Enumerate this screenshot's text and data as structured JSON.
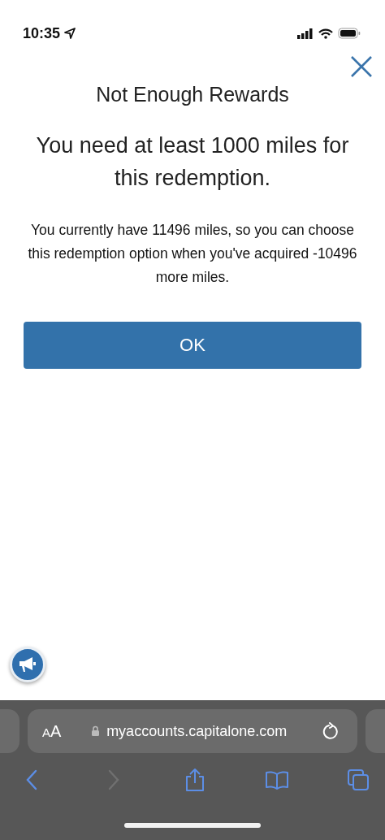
{
  "status_bar": {
    "time": "10:35"
  },
  "dialog": {
    "title": "Not Enough Rewards",
    "heading": "You need at least 1000 miles for this redemption.",
    "message": "You currently have 11496 miles, so you can choose this redemption option when you've acquired -10496 more miles.",
    "ok_button": "OK"
  },
  "browser": {
    "text_size_label": "AA",
    "url": "myaccounts.capitalone.com",
    "toolbar": [
      {
        "kind": "back",
        "disabled": false
      },
      {
        "kind": "forward",
        "disabled": true
      },
      {
        "kind": "share",
        "disabled": false
      },
      {
        "kind": "bookmarks",
        "disabled": false
      },
      {
        "kind": "tabs",
        "disabled": false
      }
    ]
  }
}
